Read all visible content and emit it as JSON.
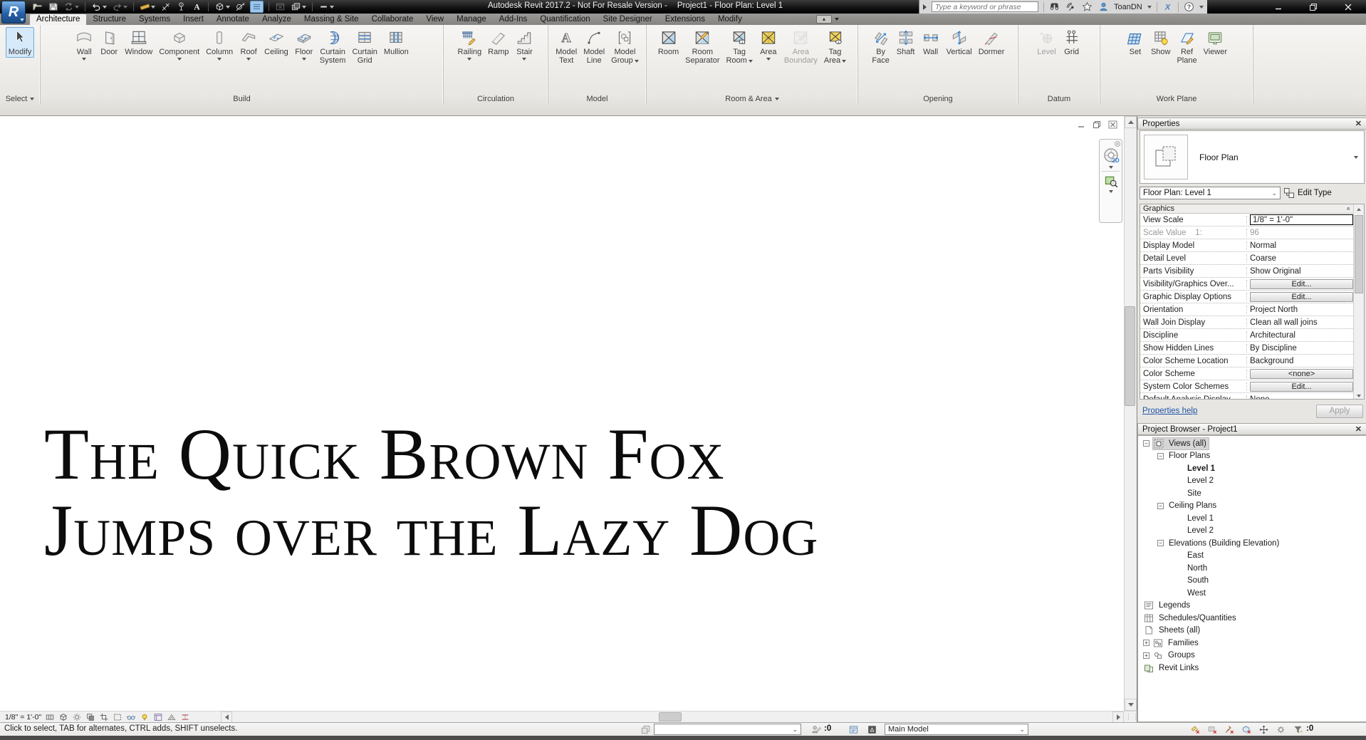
{
  "title_bar": {
    "app_button": "R",
    "app_title": "Autodesk Revit 2017.2 - Not For Resale Version -",
    "doc_title": "Project1 - Floor Plan: Level 1",
    "qat_icons": [
      {
        "name": "open"
      },
      {
        "name": "save"
      },
      {
        "name": "synchronize",
        "caret": true,
        "disabled": true
      },
      {
        "name": "undo",
        "caret": true
      },
      {
        "name": "redo",
        "caret": true,
        "disabled": true
      },
      {
        "name": "measure",
        "caret": true
      },
      {
        "name": "aligned-dimension"
      },
      {
        "name": "tag-by-category"
      },
      {
        "name": "text"
      },
      {
        "name": "default-3d-view",
        "caret": true
      },
      {
        "name": "section"
      },
      {
        "name": "thin-lines",
        "active": true
      },
      {
        "name": "close-hidden-windows",
        "disabled": true
      },
      {
        "name": "switch-windows",
        "caret": true
      },
      {
        "name": "customize-quick-access",
        "caret": true
      }
    ],
    "search_placeholder": "Type a keyword or phrase",
    "infocenter_icons": [
      "binoculars",
      "communication-center",
      "favorites",
      "sign-in"
    ],
    "username": "ToanDN",
    "exchange_icon": "exchange-apps",
    "help_icon": "help",
    "window_controls": [
      "minimize",
      "restore",
      "close"
    ]
  },
  "tab_bar": {
    "active": "Architecture",
    "tabs": [
      "Architecture",
      "Structure",
      "Systems",
      "Insert",
      "Annotate",
      "Analyze",
      "Massing & Site",
      "Collaborate",
      "View",
      "Manage",
      "Add-Ins",
      "Quantification",
      "Site Designer",
      "Extensions",
      "Modify"
    ]
  },
  "ribbon": {
    "panels": [
      {
        "label": "Select",
        "flyout": true,
        "buttons": [
          {
            "name": "modify",
            "lines": [
              "Modify"
            ],
            "active": true
          }
        ]
      },
      {
        "label": "Build",
        "buttons": [
          {
            "name": "wall",
            "lines": [
              "Wall"
            ],
            "caret": true
          },
          {
            "name": "door",
            "lines": [
              "Door"
            ]
          },
          {
            "name": "window",
            "lines": [
              "Window"
            ]
          },
          {
            "name": "component",
            "lines": [
              "Component"
            ],
            "caret": true
          },
          {
            "name": "column",
            "lines": [
              "Column"
            ],
            "caret": true
          },
          {
            "name": "roof",
            "lines": [
              "Roof"
            ],
            "caret": true
          },
          {
            "name": "ceiling",
            "lines": [
              "Ceiling"
            ]
          },
          {
            "name": "floor",
            "lines": [
              "Floor"
            ],
            "caret": true
          },
          {
            "name": "curtain-system",
            "lines": [
              "Curtain",
              "System"
            ]
          },
          {
            "name": "curtain-grid",
            "lines": [
              "Curtain",
              "Grid"
            ]
          },
          {
            "name": "mullion",
            "lines": [
              "Mullion"
            ]
          }
        ]
      },
      {
        "label": "Circulation",
        "buttons": [
          {
            "name": "railing",
            "lines": [
              "Railing"
            ],
            "caret": true
          },
          {
            "name": "ramp",
            "lines": [
              "Ramp"
            ]
          },
          {
            "name": "stair",
            "lines": [
              "Stair"
            ],
            "caret": true
          }
        ]
      },
      {
        "label": "Model",
        "buttons": [
          {
            "name": "model-text",
            "lines": [
              "Model",
              "Text"
            ]
          },
          {
            "name": "model-line",
            "lines": [
              "Model",
              "Line"
            ]
          },
          {
            "name": "model-group",
            "lines": [
              "Model",
              "Group"
            ],
            "caret": true
          }
        ]
      },
      {
        "label": "Room & Area",
        "flyout": true,
        "buttons": [
          {
            "name": "room",
            "lines": [
              "Room"
            ]
          },
          {
            "name": "room-separator",
            "lines": [
              "Room",
              "Separator"
            ]
          },
          {
            "name": "tag-room",
            "lines": [
              "Tag",
              "Room"
            ],
            "caret": true
          },
          {
            "name": "area",
            "lines": [
              "Area"
            ],
            "caret": true
          },
          {
            "name": "area-boundary",
            "lines": [
              "Area",
              "Boundary"
            ],
            "disabled": true
          },
          {
            "name": "tag-area",
            "lines": [
              "Tag",
              "Area"
            ],
            "caret": true
          }
        ]
      },
      {
        "label": "Opening",
        "buttons": [
          {
            "name": "by-face",
            "lines": [
              "By",
              "Face"
            ]
          },
          {
            "name": "shaft",
            "lines": [
              "Shaft"
            ]
          },
          {
            "name": "wall-opening",
            "lines": [
              "Wall"
            ]
          },
          {
            "name": "vertical-opening",
            "lines": [
              "Vertical"
            ]
          },
          {
            "name": "dormer",
            "lines": [
              "Dormer"
            ]
          }
        ]
      },
      {
        "label": "Datum",
        "buttons": [
          {
            "name": "level",
            "lines": [
              "Level"
            ],
            "disabled": true
          },
          {
            "name": "grid",
            "lines": [
              "Grid"
            ]
          }
        ]
      },
      {
        "label": "Work Plane",
        "buttons": [
          {
            "name": "set",
            "lines": [
              "Set"
            ]
          },
          {
            "name": "show",
            "lines": [
              "Show"
            ]
          },
          {
            "name": "ref-plane",
            "lines": [
              "Ref",
              "Plane"
            ]
          },
          {
            "name": "viewer",
            "lines": [
              "Viewer"
            ]
          }
        ]
      }
    ]
  },
  "canvas": {
    "text_line1": "The Quick Brown Fox",
    "text_line2": "Jumps over the Lazy Dog",
    "window_controls": [
      "minimize",
      "restore",
      "close"
    ],
    "navigation": {
      "wheel_label": "2D",
      "icons": [
        "steering-wheel",
        "zoom-region"
      ]
    }
  },
  "properties": {
    "header": "Properties",
    "type_name": "Floor Plan",
    "type_selector_value": "Floor Plan: Level 1",
    "edit_type_label": "Edit Type",
    "section_header": "Graphics",
    "rows": [
      {
        "label": "View Scale",
        "value": "1/8\" = 1'-0\"",
        "state": "selected"
      },
      {
        "label": "Scale Value    1:",
        "value": "96",
        "state": "disabled"
      },
      {
        "label": "Display Model",
        "value": "Normal"
      },
      {
        "label": "Detail Level",
        "value": "Coarse"
      },
      {
        "label": "Parts Visibility",
        "value": "Show Original"
      },
      {
        "label": "Visibility/Graphics Over...",
        "value": "Edit...",
        "state": "button"
      },
      {
        "label": "Graphic Display Options",
        "value": "Edit...",
        "state": "button"
      },
      {
        "label": "Orientation",
        "value": "Project North"
      },
      {
        "label": "Wall Join Display",
        "value": "Clean all wall joins"
      },
      {
        "label": "Discipline",
        "value": "Architectural"
      },
      {
        "label": "Show Hidden Lines",
        "value": "By Discipline"
      },
      {
        "label": "Color Scheme Location",
        "value": "Background"
      },
      {
        "label": "Color Scheme",
        "value": "<none>",
        "state": "button"
      },
      {
        "label": "System Color Schemes",
        "value": "Edit...",
        "state": "button"
      },
      {
        "label": "Default Analysis Display",
        "value": "None"
      }
    ],
    "help_link": "Properties help",
    "apply_label": "Apply"
  },
  "project_browser": {
    "header": "Project Browser - Project1",
    "tree": [
      {
        "label": "Views (all)",
        "depth": 0,
        "expander": "minus",
        "icon": "views",
        "selected": true
      },
      {
        "label": "Floor Plans",
        "depth": 1,
        "expander": "minus"
      },
      {
        "label": "Level 1",
        "depth": 2,
        "bold": true
      },
      {
        "label": "Level 2",
        "depth": 2
      },
      {
        "label": "Site",
        "depth": 2
      },
      {
        "label": "Ceiling Plans",
        "depth": 1,
        "expander": "minus"
      },
      {
        "label": "Level 1",
        "depth": 2
      },
      {
        "label": "Level 2",
        "depth": 2
      },
      {
        "label": "Elevations (Building Elevation)",
        "depth": 1,
        "expander": "minus"
      },
      {
        "label": "East",
        "depth": 2
      },
      {
        "label": "North",
        "depth": 2
      },
      {
        "label": "South",
        "depth": 2
      },
      {
        "label": "West",
        "depth": 2
      },
      {
        "label": "Legends",
        "depth": 0,
        "icon": "legends"
      },
      {
        "label": "Schedules/Quantities",
        "depth": 0,
        "icon": "schedules"
      },
      {
        "label": "Sheets (all)",
        "depth": 0,
        "icon": "sheets"
      },
      {
        "label": "Families",
        "depth": 0,
        "expander": "plus",
        "icon": "families"
      },
      {
        "label": "Groups",
        "depth": 0,
        "expander": "plus",
        "icon": "groups"
      },
      {
        "label": "Revit Links",
        "depth": 0,
        "icon": "revit-links"
      }
    ]
  },
  "view_control_bar": {
    "scale": "1/8\" = 1'-0\"",
    "icons": [
      "detail-level",
      "visual-style",
      "sun-path",
      "shadows",
      "crop-view",
      "show-crop",
      "temporary-hide-isolate",
      "reveal-hidden-elements",
      "temporary-view-properties",
      "hide-analytical-model",
      "reveal-constraints"
    ]
  },
  "status_bar": {
    "hint": "Click to select, TAB for alternates, CTRL adds, SHIFT unselects.",
    "workset_value": "",
    "editable_only_count": ":0",
    "design_option": "Main Model",
    "selection_count": ":0",
    "right_icons": [
      "select-links",
      "select-underlay",
      "select-pinned",
      "select-by-face",
      "drag-on-selection",
      "background-processes"
    ]
  },
  "colors": {
    "selection_highlight": "#d5e9fa",
    "area_yellow": "#f2d359",
    "room_blue": "#b9d7e8",
    "titlebar": "#000000",
    "ribbon_bg": "#ece9e5"
  }
}
